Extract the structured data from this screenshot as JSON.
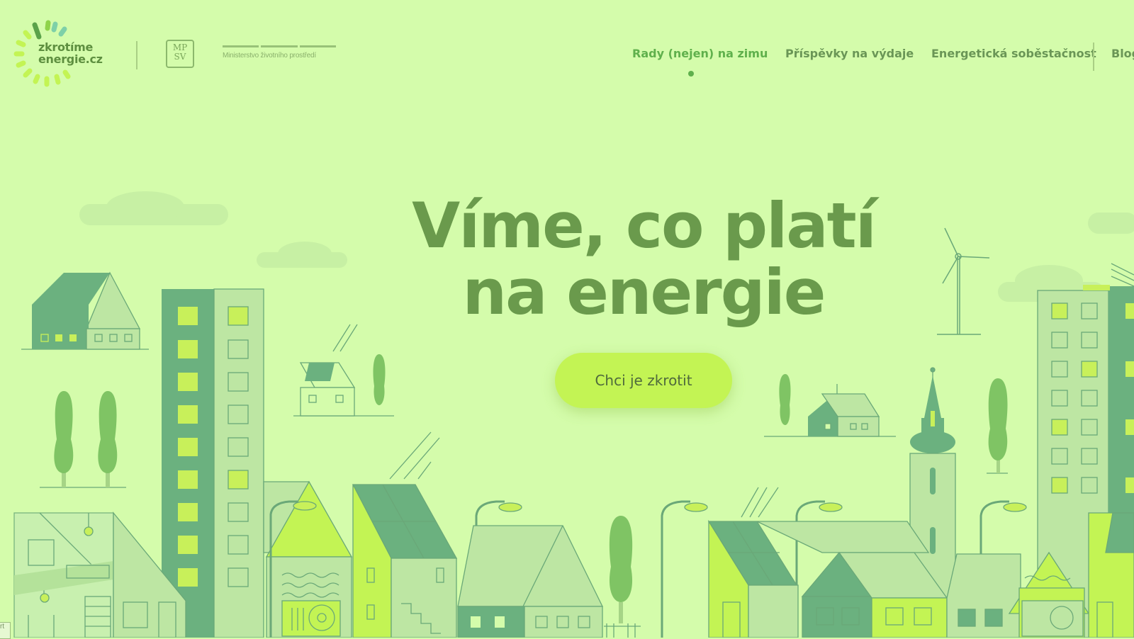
{
  "logo": {
    "line1": "zkrotíme",
    "line2": "energie.cz"
  },
  "partners": {
    "mpsv_line1": "MP",
    "mpsv_line2": "SV",
    "ministry": "Ministerstvo životního prostředí"
  },
  "nav": {
    "items": [
      {
        "label": "Rady (nejen) na zimu",
        "active": true
      },
      {
        "label": "Příspěvky na výdaje",
        "active": false
      },
      {
        "label": "Energetická soběstačnost",
        "active": false
      },
      {
        "label": "Blog",
        "active": false
      }
    ]
  },
  "hero": {
    "title_line1": "Víme, co platí",
    "title_line2": "na energie",
    "cta": "Chci je zkrotit"
  },
  "corner": {
    "label": "rt"
  },
  "colors": {
    "background": "#d4fcab",
    "accent": "#c3f454",
    "dark_green": "#6bb17f",
    "title": "#6a9a4c",
    "nav_active": "#5fb04c"
  }
}
